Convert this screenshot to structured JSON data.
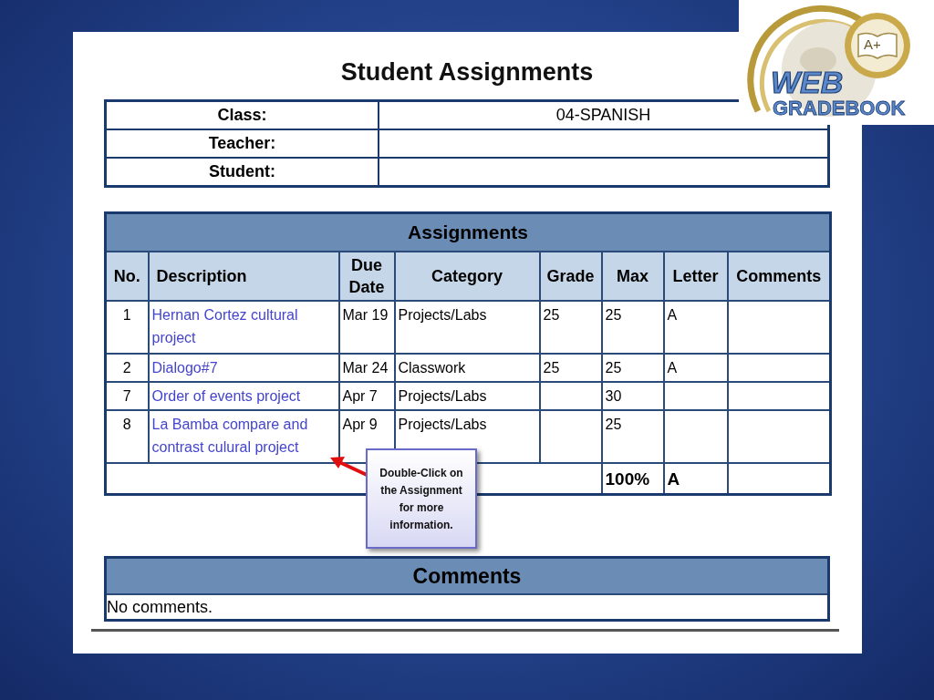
{
  "logo": {
    "badge": "A+",
    "word": "WEB",
    "subword": "GRADEBOOK"
  },
  "title": "Student Assignments",
  "info": [
    {
      "label": "Class:",
      "value": "04-SPANISH"
    },
    {
      "label": "Teacher:"
    },
    {
      "label": "Student:"
    }
  ],
  "assignments": {
    "title": "Assignments",
    "columns": [
      "No.",
      "Description",
      "Due Date",
      "Category",
      "Grade",
      "Max",
      "Letter",
      "Comments"
    ],
    "rows": [
      {
        "no": "1",
        "description": "Hernan Cortez cultural project",
        "due": "Mar 19",
        "category": "Projects/Labs",
        "grade": "25",
        "max": "25",
        "letter": "A"
      },
      {
        "no": "2",
        "description": "Dialogo#7",
        "due": "Mar 24",
        "category": "Classwork",
        "grade": "25",
        "max": "25",
        "letter": "A"
      },
      {
        "no": "7",
        "description": "Order of events project",
        "due": "Apr 7",
        "category": "Projects/Labs",
        "max": "30"
      },
      {
        "no": "8",
        "description": "La Bamba compare and contrast culural project",
        "due": "Apr 9",
        "category": "Projects/Labs",
        "max": "25"
      }
    ],
    "total": {
      "percent": "100%",
      "letter": "A"
    }
  },
  "callout": "Double-Click on the Assignment for more information.",
  "comments": {
    "title": "Comments",
    "text": "No comments."
  }
}
